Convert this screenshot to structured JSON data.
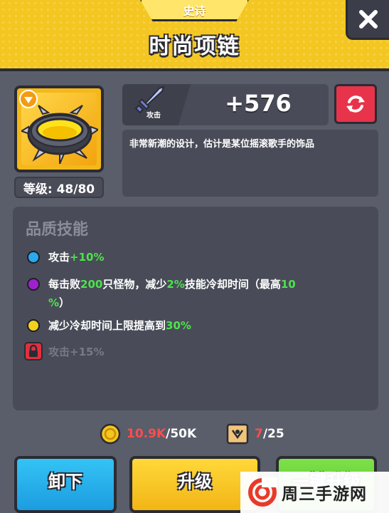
{
  "header": {
    "rarity": "史诗",
    "title": "时尚项链"
  },
  "item": {
    "icon": "spiked-ring-icon",
    "level_text": "等级: 48/80"
  },
  "stats": {
    "attack_label": "攻击",
    "attack_value": "+576",
    "description": "非常新潮的设计，估计是某位摇滚歌手的饰品"
  },
  "skills": {
    "title": "品质技能",
    "items": [
      {
        "color": "#2aa8f0",
        "segments": [
          "攻击",
          "+10%"
        ],
        "locked": false
      },
      {
        "color": "#a020d0",
        "segments": [
          "每击败",
          "200",
          "只怪物，减少",
          "2%",
          "技能冷却时间（最高",
          "10",
          "%",
          "）"
        ],
        "locked": false
      },
      {
        "color": "#f4d21c",
        "segments": [
          "减少冷却时间上限提高到",
          "30%"
        ],
        "locked": false
      },
      {
        "color": "#e0303e",
        "segments": [
          "攻击+15%"
        ],
        "locked": true
      }
    ]
  },
  "resources": {
    "gold_current": "10.9K",
    "gold_total": "/50K",
    "scroll_current": "7",
    "scroll_total": "/25"
  },
  "buttons": {
    "unequip": "卸下",
    "upgrade": "升级",
    "one_click_upgrade": "一键升级"
  },
  "watermark": {
    "text": "周三手游网"
  },
  "colors": {
    "header_yellow": "#f4c621",
    "panel": "#494c58",
    "background": "#5a5d6a",
    "green_text": "#4de24d",
    "red_text": "#ff4d4d"
  }
}
